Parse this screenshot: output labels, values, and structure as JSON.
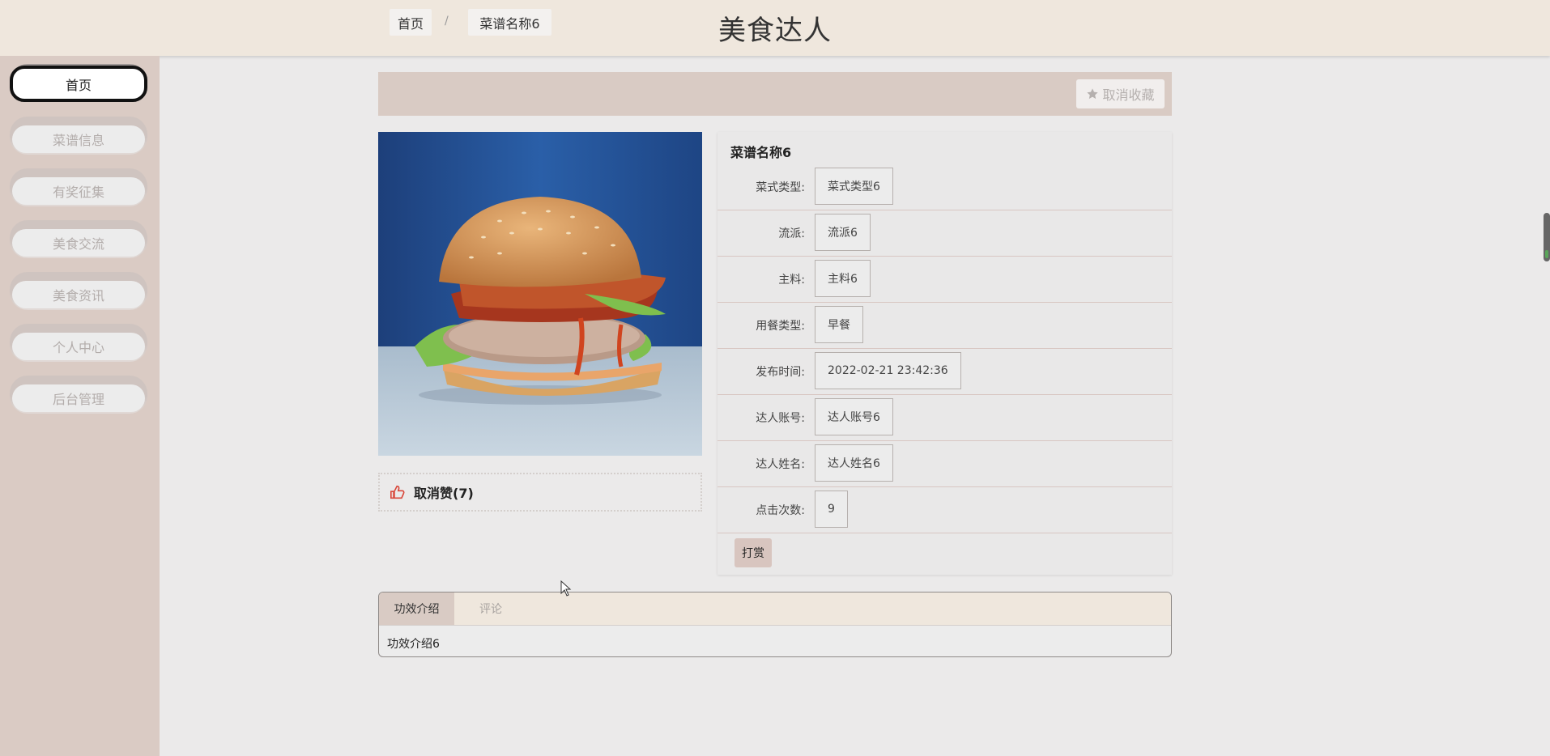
{
  "app": {
    "title": "美食达人"
  },
  "sidebar": {
    "items": [
      {
        "label": "首页",
        "active": true
      },
      {
        "label": "菜谱信息",
        "active": false
      },
      {
        "label": "有奖征集",
        "active": false
      },
      {
        "label": "美食交流",
        "active": false
      },
      {
        "label": "美食资讯",
        "active": false
      },
      {
        "label": "个人中心",
        "active": false
      },
      {
        "label": "后台管理",
        "active": false
      }
    ]
  },
  "breadcrumb": {
    "home": "首页",
    "separator": "/",
    "current": "菜谱名称6"
  },
  "favorite_button": {
    "label": "取消收藏",
    "icon": "star-icon"
  },
  "photo": {
    "alt": "hamburger-photo"
  },
  "like": {
    "label": "取消赞(7)",
    "icon": "thumbs-up-icon"
  },
  "details": {
    "title": "菜谱名称6",
    "rows": [
      {
        "label": "菜式类型:",
        "value": "菜式类型6"
      },
      {
        "label": "流派:",
        "value": "流派6"
      },
      {
        "label": "主料:",
        "value": "主料6"
      },
      {
        "label": "用餐类型:",
        "value": "早餐"
      },
      {
        "label": "发布时间:",
        "value": "2022-02-21 23:42:36"
      },
      {
        "label": "达人账号:",
        "value": "达人账号6"
      },
      {
        "label": "达人姓名:",
        "value": "达人姓名6"
      },
      {
        "label": "点击次数:",
        "value": "9"
      }
    ],
    "reward_button": "打赏"
  },
  "tabs": {
    "items": [
      {
        "label": "功效介绍",
        "active": true
      },
      {
        "label": "评论",
        "active": false
      }
    ],
    "content": "功效介绍6"
  },
  "colors": {
    "header_bg": "#efe7dd",
    "sidebar_bg": "#dacbc4",
    "accent": "#d9cbc4",
    "like_icon": "#d9483b"
  }
}
